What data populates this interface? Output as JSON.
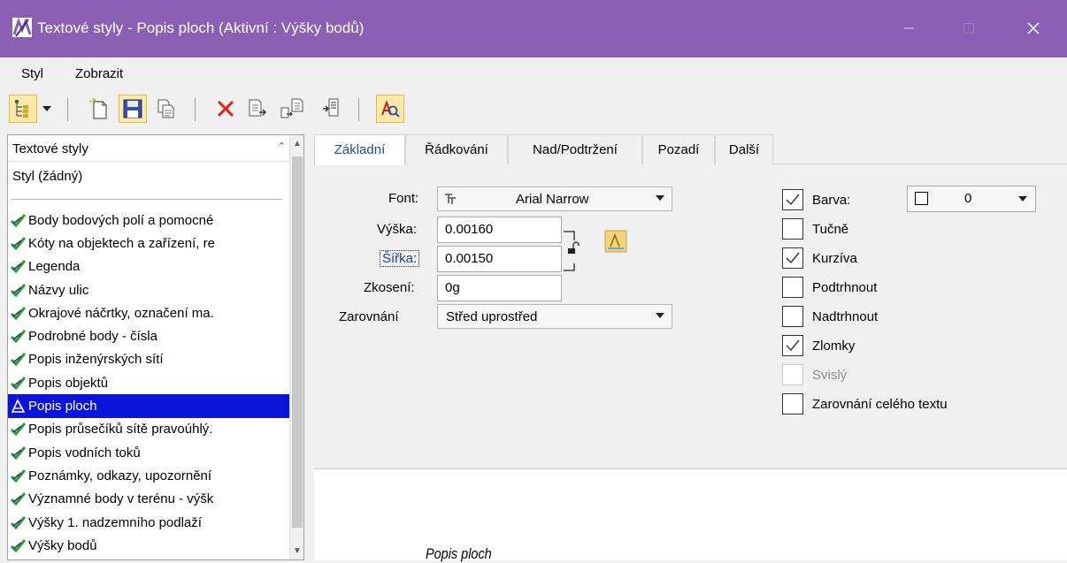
{
  "window": {
    "title": "Textové styly - Popis ploch (Aktivní : Výšky bodů)",
    "minimize": "—",
    "maximize": "☐",
    "close": "✕"
  },
  "menu": [
    "Styl",
    "Zobrazit"
  ],
  "toolbar": {
    "icons": [
      "tree-view",
      "dropdown",
      "new",
      "save",
      "copy",
      "delete",
      "import",
      "export",
      "update",
      "find-preview"
    ]
  },
  "styles_list": {
    "header": "Textové styly",
    "none_item": "Styl (žádný)",
    "items": [
      "Body bodových polí a pomocné",
      "Kóty na objektech a zařízení, re",
      "Legenda",
      "Názvy ulic",
      "Okrajové náčrtky, označení ma.",
      "Podrobné body - čísla",
      "Popis inženýrských sítí",
      "Popis objektů",
      "Popis ploch",
      "Popis průsečíků sítě pravoúhlý.",
      "Popis vodních toků",
      "Poznámky, odkazy, upozornění",
      "Významné body v terénu - výšk",
      "Výšky 1. nadzemního podlaží",
      "Výšky bodů"
    ],
    "selected_index": 8
  },
  "tabs": [
    "Základní",
    "Řádkování",
    "Nad/Podtržení",
    "Pozadí",
    "Další"
  ],
  "active_tab": 0,
  "form": {
    "font_label": "Font:",
    "font_value": "Arial Narrow",
    "height_label": "Výška:",
    "height_value": "0.00160",
    "width_label": "Šířka:",
    "width_value": "0.00150",
    "slant_label": "Zkosení:",
    "slant_value": "0g",
    "justification_label": "Zarovnání",
    "justification_value": "Střed uprostřed"
  },
  "options": {
    "color_label": "Barva:",
    "color_value": "0",
    "bold": "Tučně",
    "italic": "Kurzíva",
    "underline": "Podtrhnout",
    "overline": "Nadtrhnout",
    "fractions": "Zlomky",
    "vertical": "Svislý",
    "full_justify": "Zarovnání celého textu",
    "checked": {
      "color": true,
      "bold": false,
      "italic": true,
      "underline": false,
      "overline": false,
      "fractions": true,
      "vertical": false,
      "full_justify": false
    }
  },
  "preview": {
    "text": "Popis ploch"
  },
  "colors": {
    "titlebar": "#8b5fb4",
    "selection": "#0a15d9",
    "check_green": "#2e9b2e"
  }
}
